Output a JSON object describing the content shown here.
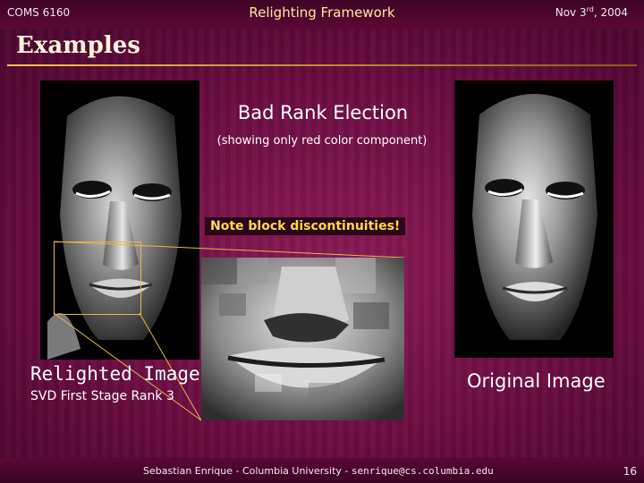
{
  "header": {
    "course": "COMS 6160",
    "title": "Relighting Framework",
    "date_prefix": "Nov 3",
    "date_sup": "rd",
    "date_suffix": ", 2004"
  },
  "slide": {
    "heading": "Examples",
    "subtitle": "Bad Rank Election",
    "subtitle_note": "(showing only red color component)",
    "warning": "Note block discontinuities!",
    "left_label": "Relighted Image",
    "left_sublabel": "SVD First Stage Rank 3",
    "right_label": "Original Image"
  },
  "footer": {
    "credit": "Sebastian Enrique - Columbia University - ",
    "email": "senrique@cs.columbia.edu",
    "page": "16"
  },
  "colors": {
    "background": "#6d0e43",
    "heading_rule": "#f1c24d",
    "warning_text": "#ffd84a"
  },
  "icons": {
    "left_face": "face-render-relighted",
    "right_face": "face-render-original",
    "zoom": "lips-zoom-detail"
  }
}
